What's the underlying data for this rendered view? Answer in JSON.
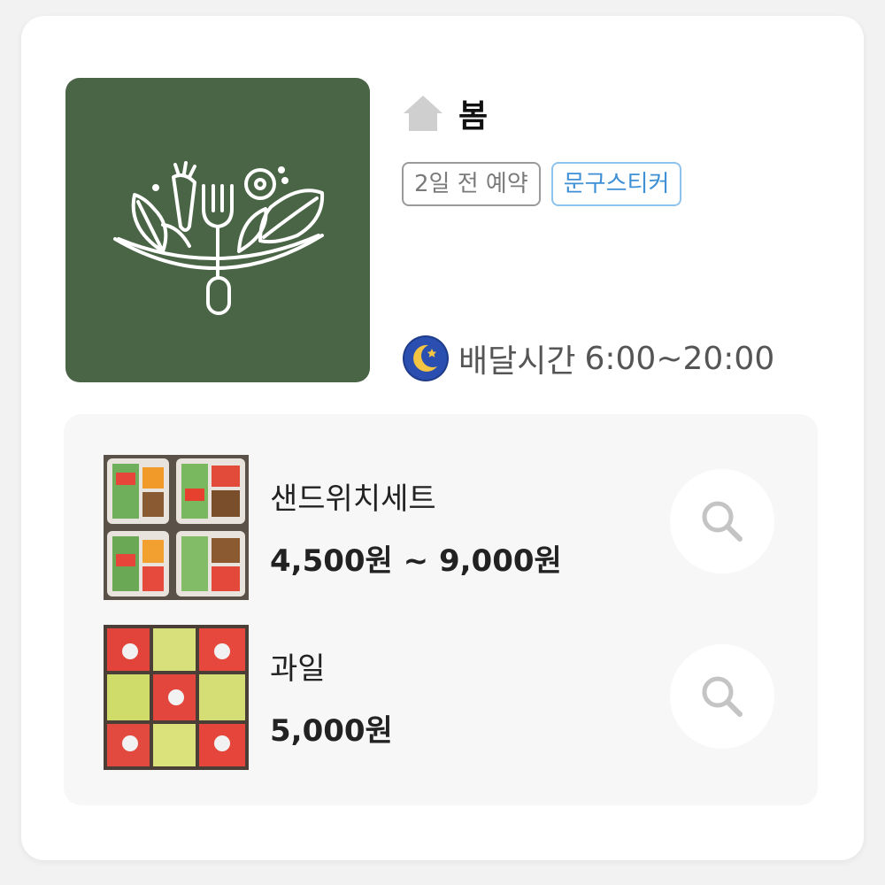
{
  "store": {
    "name": "봄",
    "tags": [
      "2일 전 예약",
      "문구스티커"
    ],
    "delivery_label": "배달시간",
    "delivery_time": "6:00~20:00"
  },
  "icons": {
    "store": "home-icon",
    "delivery": "moon-icon",
    "zoom": "magnifier-icon"
  },
  "colors": {
    "logo_bg": "#4a6446",
    "tag_blue": "#3d8fd6",
    "panel_bg": "#f7f7f7"
  },
  "products": [
    {
      "name": "샌드위치세트",
      "price": "4,500원 ~ 9,000원"
    },
    {
      "name": "과일",
      "price": "5,000원"
    }
  ]
}
